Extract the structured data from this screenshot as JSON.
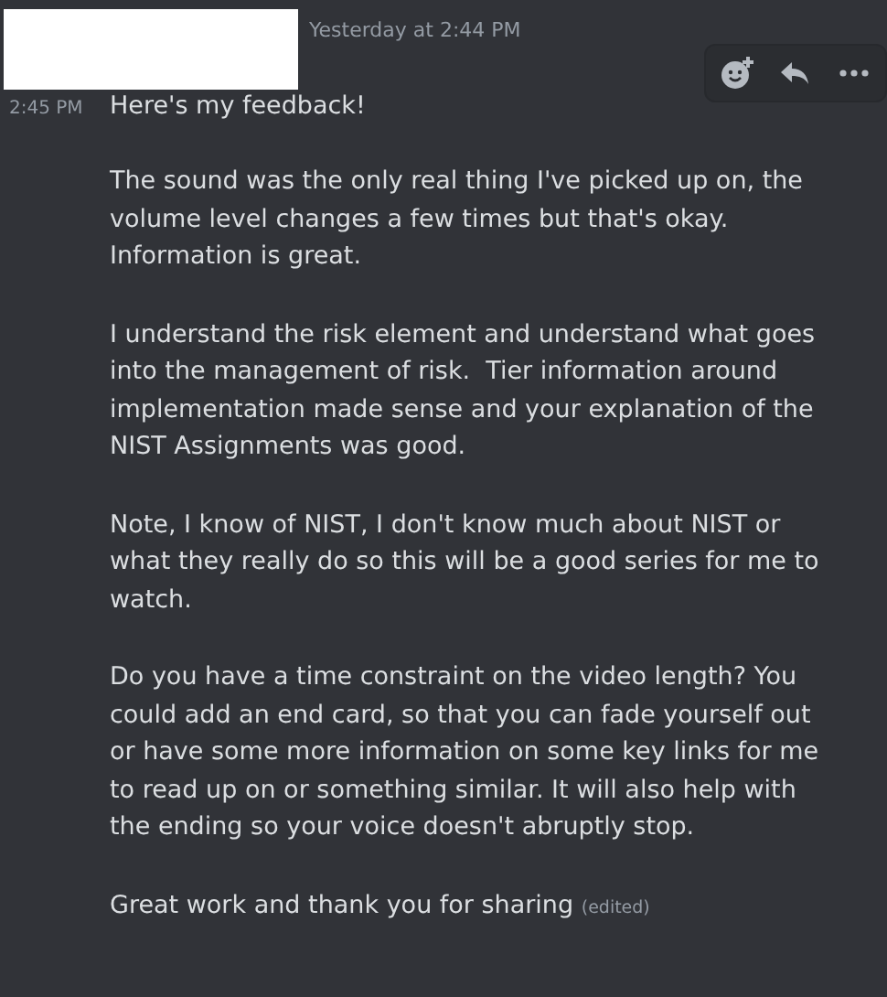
{
  "message": {
    "header_time": "Yesterday at 2:44 PM",
    "lines": [
      {
        "time": "2:45 PM",
        "text": "Here's my feedback!"
      },
      {
        "text": "The sound was the only real thing I've picked up on, the volume level changes a few times but that's okay. Information is great."
      },
      {
        "text": "I understand the risk element and understand what goes into the management of risk.  Tier information around implementation made sense and your explanation of the NIST Assignments was good."
      },
      {
        "text": "Note, I know of NIST, I don't know much about NIST or what they really do so this will be a good series for me to watch."
      },
      {
        "text": "Do you have a time constraint on the video length? You could add an end card, so that you can fade yourself out or have some more information on some key links for me to read up on or something similar. It will also help with the ending so your voice doesn't abruptly stop."
      },
      {
        "text": "Great work and thank you for sharing",
        "edited_label": "(edited)"
      }
    ]
  },
  "actions": [
    {
      "kind": "reaction"
    },
    {
      "kind": "reply"
    },
    {
      "kind": "more"
    }
  ]
}
